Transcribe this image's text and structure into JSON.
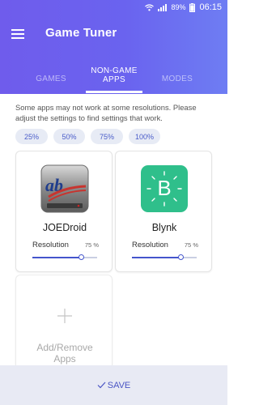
{
  "status_bar": {
    "battery_percent": "89%",
    "time": "06:15"
  },
  "header": {
    "title": "Game Tuner",
    "menu_icon": "hamburger-menu-icon"
  },
  "tabs": [
    {
      "label": "GAMES",
      "selected": false
    },
    {
      "label": "NON-GAME\nAPPS",
      "selected": true
    },
    {
      "label": "MODES",
      "selected": false
    }
  ],
  "tab_nongame_line1": "NON-GAME",
  "tab_nongame_line2": "APPS",
  "notice": "Some apps may not work at some resolutions. Please adjust the settings to find settings that work.",
  "chips": [
    "25%",
    "50%",
    "75%",
    "100%"
  ],
  "apps": [
    {
      "name": "JOEDroid",
      "icon": "joedroid-app-icon",
      "resolution_label": "Resolution",
      "resolution_value": "75 %",
      "resolution_level": 0.75
    },
    {
      "name": "Blynk",
      "icon": "blynk-app-icon",
      "icon_letter": "B",
      "resolution_label": "Resolution",
      "resolution_value": "75 %",
      "resolution_level": 0.75
    }
  ],
  "add_card": {
    "line1": "Add/Remove",
    "line2": "Apps",
    "icon": "plus-icon"
  },
  "save_button": {
    "label": "SAVE",
    "icon": "check-icon"
  },
  "colors": {
    "header_start": "#6f5cec",
    "header_end": "#6e7df3",
    "accent": "#4455cc",
    "blynk_green": "#2fbf8b",
    "save_bar_bg": "#e8eaf4"
  }
}
